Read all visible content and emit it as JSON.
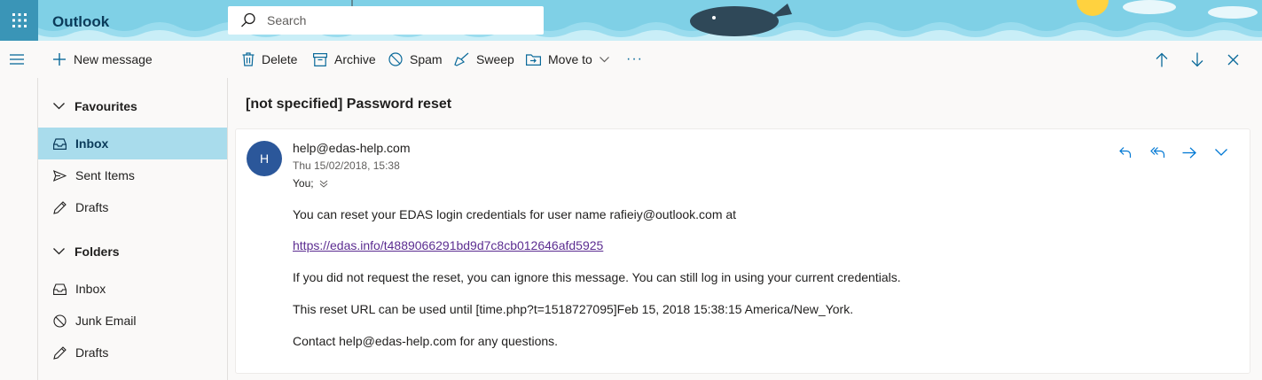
{
  "header": {
    "app_title": "Outlook",
    "search_placeholder": "Search"
  },
  "toolbar": {
    "new_message_label": "New message",
    "delete_label": "Delete",
    "archive_label": "Archive",
    "spam_label": "Spam",
    "sweep_label": "Sweep",
    "move_to_label": "Move to",
    "more_label": "···"
  },
  "sidebar": {
    "favourites_header": "Favourites",
    "favourites": [
      {
        "label": "Inbox",
        "icon": "inbox-icon",
        "selected": true
      },
      {
        "label": "Sent Items",
        "icon": "send-icon",
        "selected": false
      },
      {
        "label": "Drafts",
        "icon": "pencil-icon",
        "selected": false
      }
    ],
    "folders_header": "Folders",
    "folders": [
      {
        "label": "Inbox",
        "icon": "inbox-icon"
      },
      {
        "label": "Junk Email",
        "icon": "block-icon"
      },
      {
        "label": "Drafts",
        "icon": "pencil-icon"
      }
    ]
  },
  "message": {
    "subject": "[not specified] Password reset",
    "avatar_initial": "H",
    "from": "help@edas-help.com",
    "date": "Thu 15/02/2018, 15:38",
    "to": "You;",
    "body": {
      "line1": "You can reset your EDAS login credentials for user name rafieiy@outlook.com at",
      "link": "https://edas.info/t4889066291bd9d7c8cb012646afd5925",
      "line2": "If you did not request the reset, you can ignore this message. You can still log in using your current credentials.",
      "line3": "This reset URL can be used until [time.php?t=1518727095]Feb 15, 2018 15:38:15 America/New_York.",
      "line4": "Contact help@edas-help.com for any questions."
    }
  },
  "colors": {
    "header_bg": "#7fd0e6",
    "waffle_bg": "#3a95b7",
    "selected_bg": "#a9dcec",
    "accent": "#0078d4",
    "avatar_bg": "#2b579a",
    "link": "#5c2d91"
  }
}
